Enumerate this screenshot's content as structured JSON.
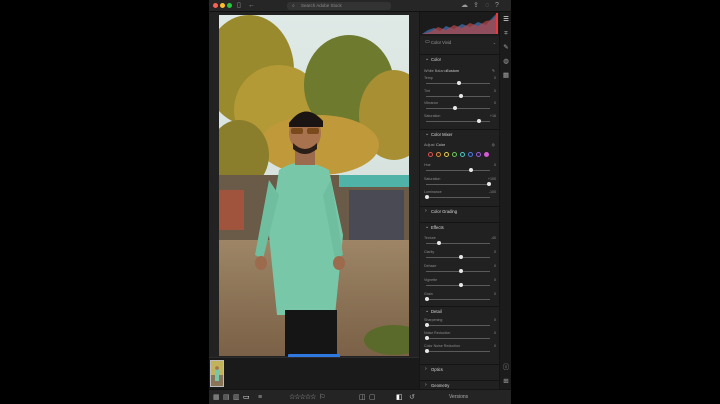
{
  "window": {
    "search_placeholder": "Search Adobe Stock"
  },
  "toast": {
    "text": "Undo Texture = -0(+40)"
  },
  "panel": {
    "profile": {
      "label": "Color Vivid"
    },
    "color_section": {
      "title": "Color",
      "white_balance_label": "White Balance",
      "white_balance_value": "Custom",
      "sliders": [
        {
          "label": "Temp",
          "value": "0",
          "pos": 0.52
        },
        {
          "label": "Tint",
          "value": "0",
          "pos": 0.55
        },
        {
          "label": "Vibrance",
          "value": "0",
          "pos": 0.45
        },
        {
          "label": "Saturation",
          "value": "+16",
          "pos": 0.83
        }
      ]
    },
    "color_mixer": {
      "title": "Color Mixer",
      "adjust_label": "Adjust",
      "adjust_value": "Color",
      "swatch_colors": [
        "#e05050",
        "#e08a3a",
        "#e0c84a",
        "#6dc85a",
        "#4ec8c0",
        "#4a7de0",
        "#9a5ae0",
        "#d65ad8"
      ],
      "sliders": [
        {
          "label": "Hue",
          "value": "0",
          "pos": 0.7
        },
        {
          "label": "Saturation",
          "value": "+100",
          "pos": 0.99
        },
        {
          "label": "Luminance",
          "value": "-100",
          "pos": 0.02
        }
      ]
    },
    "color_grading": {
      "title": "Color Grading"
    },
    "effects": {
      "title": "Effects",
      "sliders": [
        {
          "label": "Texture",
          "value": "-40",
          "pos": 0.2
        },
        {
          "label": "Clarity",
          "value": "0",
          "pos": 0.55
        },
        {
          "label": "Dehaze",
          "value": "0",
          "pos": 0.55
        },
        {
          "label": "Vignette",
          "value": "0",
          "pos": 0.55
        },
        {
          "label": "Grain",
          "value": "0",
          "pos": 0.02
        }
      ]
    },
    "detail": {
      "title": "Detail",
      "sliders": [
        {
          "label": "Sharpening",
          "value": "0",
          "pos": 0.02
        },
        {
          "label": "Noise Reduction",
          "value": "0",
          "pos": 0.02
        },
        {
          "label": "Color Noise Reduction",
          "value": "0",
          "pos": 0.02
        }
      ]
    },
    "optics": {
      "title": "Optics"
    },
    "geometry": {
      "title": "Geometry"
    }
  },
  "bottom_bar": {
    "versions_label": "Versions"
  }
}
